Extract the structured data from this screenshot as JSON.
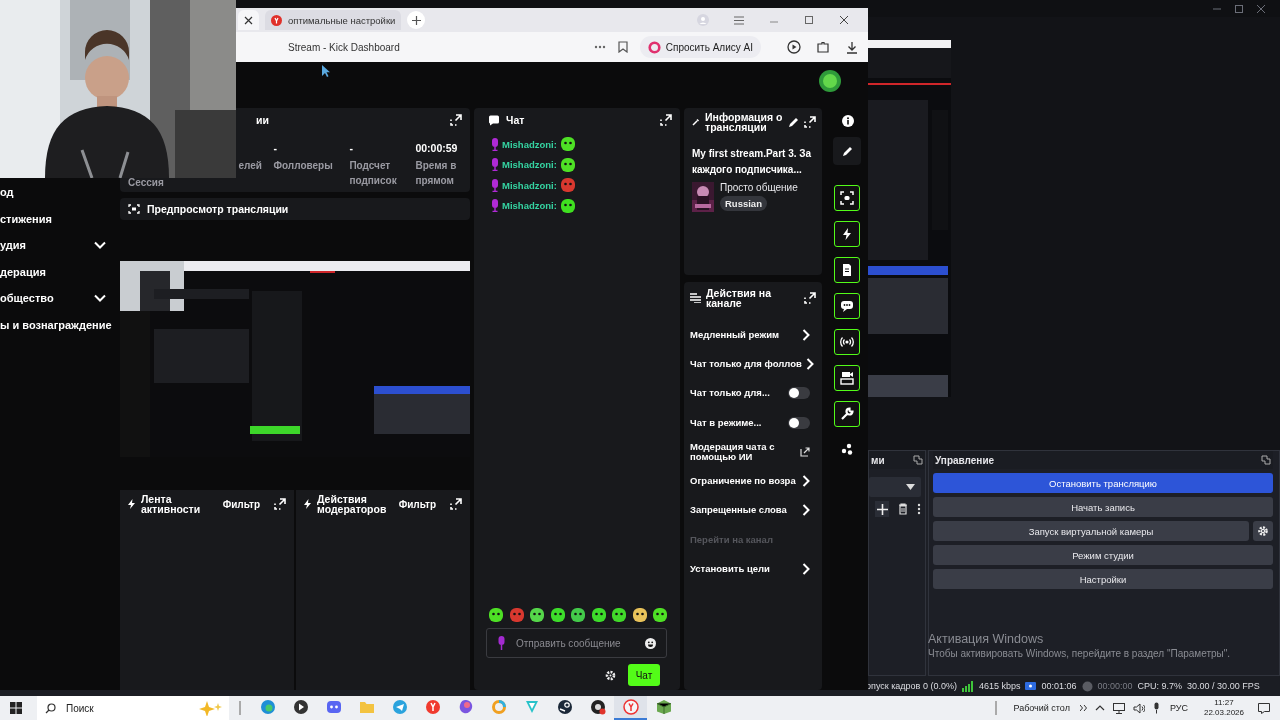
{
  "obs": {
    "sources_dock": {
      "title": "ми"
    },
    "controls": {
      "title": "Управление",
      "buttons": [
        {
          "label": "Остановить трансляцию",
          "active": true,
          "kind": "plain"
        },
        {
          "label": "Начать запись",
          "active": false,
          "kind": "plain"
        },
        {
          "label": "Запуск виртуальной камеры",
          "active": false,
          "kind": "with_settings"
        },
        {
          "label": "Режим студии",
          "active": false,
          "kind": "plain"
        },
        {
          "label": "Настройки",
          "active": false,
          "kind": "plain"
        }
      ]
    },
    "status_bar": {
      "dropped_frames": "опуск кадров 0 (0.0%)",
      "bitrate": "4615 kbps",
      "streaming": true,
      "stream_time": "00:01:06",
      "recording": false,
      "record_time": "00:00:00",
      "cpu": "CPU: 9.7%",
      "fps": "30.00 / 30.00 FPS"
    }
  },
  "browser": {
    "tabs": [
      {
        "selected": true
      },
      {
        "title": "оптимальные настройки",
        "selected": false
      }
    ],
    "address": "Stream - Kick Dashboard",
    "alice_button": "Спросить Алису AI"
  },
  "kick": {
    "sidebar": [
      {
        "label": "од",
        "kind": "link"
      },
      {
        "label": "стижения",
        "kind": "link"
      },
      {
        "label": "удия",
        "kind": "group"
      },
      {
        "label": "дерация",
        "kind": "link"
      },
      {
        "label": "общество",
        "kind": "group"
      },
      {
        "label": "ы и вознаграждение",
        "kind": "link"
      }
    ],
    "stats": {
      "title": "ии",
      "session": "Сессия",
      "items": [
        {
          "label": "елей"
        },
        {
          "value": "-",
          "label": "Фолловеры"
        },
        {
          "value": "-",
          "label": "Подсчет подписок"
        },
        {
          "value": "00:00:59",
          "label": "Время в прямом"
        }
      ]
    },
    "preview": {
      "title": "Предпросмотр трансляции"
    },
    "panels": [
      {
        "title": "Лента активности",
        "filter": "Фильтр"
      },
      {
        "title": "Действия модераторов",
        "filter": "Фильтр"
      }
    ],
    "chat": {
      "title": "Чат",
      "messages": [
        {
          "user": "Mishadzoni:"
        },
        {
          "user": "Mishadzoni:"
        },
        {
          "user": "Mishadzoni:"
        },
        {
          "user": "Mishadzoni:"
        }
      ],
      "input": {
        "placeholder": "Отправить сообщение"
      },
      "send": "Чат"
    },
    "info": {
      "title": "Информация о трансляции",
      "stream_title": "My first stream.Part 3. За каждого подписчика...",
      "category": "Просто общение",
      "language": "Russian"
    },
    "actions": {
      "title": "Действия на канале",
      "items": [
        {
          "label": "Медленный режим",
          "kind": "submenu",
          "disabled": false
        },
        {
          "label": "Чат только для фоллов",
          "kind": "submenu",
          "disabled": false
        },
        {
          "label": "Чат только для...",
          "kind": "toggle",
          "on": false,
          "disabled": false
        },
        {
          "label": "Чат в режиме...",
          "kind": "toggle",
          "on": false,
          "disabled": false
        },
        {
          "label": "Модерация чата с помощью ИИ",
          "kind": "external",
          "disabled": false
        },
        {
          "label": "Ограничение по возра",
          "kind": "submenu",
          "disabled": false
        },
        {
          "label": "Запрещенные слова",
          "kind": "submenu",
          "disabled": false
        },
        {
          "label": "Перейти на канал",
          "kind": "link",
          "disabled": true
        },
        {
          "label": "Установить цели",
          "kind": "submenu",
          "disabled": false
        }
      ]
    }
  },
  "activation": {
    "title": "Активация Windows",
    "text": "Чтобы активировать Windows, перейдите в раздел \"Параметры\"."
  },
  "taskbar": {
    "search": {
      "placeholder": "Поиск"
    },
    "apps": [
      {
        "selected": false
      },
      {
        "selected": false
      },
      {
        "selected": false
      },
      {
        "selected": false
      },
      {
        "selected": false
      },
      {
        "selected": false
      },
      {
        "selected": false
      },
      {
        "selected": false
      },
      {
        "selected": false
      },
      {
        "selected": false
      },
      {
        "selected": false
      },
      {
        "selected": true
      },
      {
        "selected": false
      }
    ],
    "desktop_label": "Рабочий стол",
    "language": "РУС",
    "time": "11:27",
    "date": "22.03.2026"
  }
}
